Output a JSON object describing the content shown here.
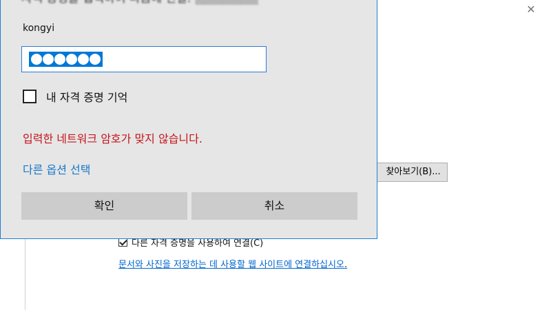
{
  "background_window": {
    "close_glyph": "✕",
    "browse_button": "찾아보기(B)...",
    "checkbox_label": "다른 자격 증명을 사용하여 연결(C)",
    "link_text": "문서와 사진을 저장하는 데 사용할 웹 사이트에 연결하십시오",
    "link_suffix": "."
  },
  "dialog": {
    "heading": "자격 증명을 입력하여 다음에 연결:",
    "username": "kongyi",
    "password_mask_count": 6,
    "remember_label": "내 자격 증명 기억",
    "remember_checked": false,
    "error_message": "입력한 네트워크 암호가 맞지 않습니다.",
    "more_options": "다른 옵션 선택",
    "ok_button": "확인",
    "cancel_button": "취소"
  },
  "colors": {
    "accent": "#0078d7",
    "error": "#c4141a",
    "link": "#1877c9",
    "dialog_bg": "#e6e6e6",
    "button_bg": "#cccccc"
  }
}
